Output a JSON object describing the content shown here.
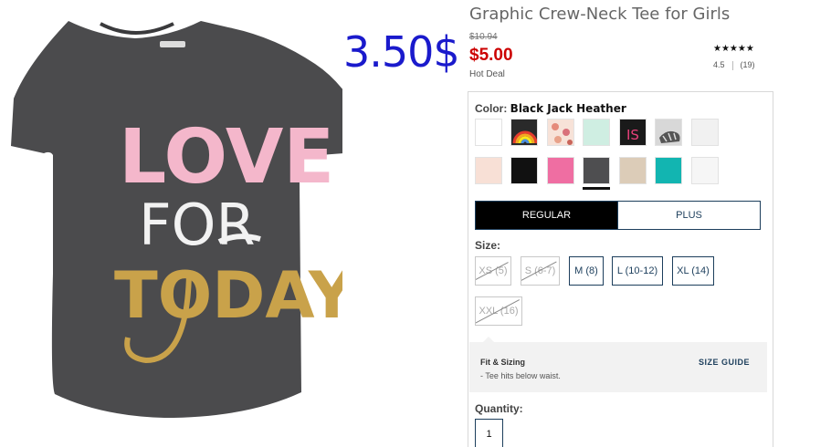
{
  "overlay_price": "3.50$",
  "product": {
    "title": "Graphic Crew-Neck Tee for Girls",
    "old_price": "$10.94",
    "sale_price": "$5.00",
    "deal_label": "Hot Deal",
    "rating_stars": "★★★★★",
    "rating_value": "4.5",
    "rating_count": "(19)",
    "image": {
      "graphic_line1": "LOVE",
      "graphic_line2": "FOR",
      "graphic_line3": "TODAY",
      "shirt_color": "#4b4b4d",
      "pink_color": "#f4b7cb",
      "gold_color": "#c9a24a"
    }
  },
  "color": {
    "label": "Color:",
    "selected": "Black Jack Heather",
    "swatches": [
      {
        "name": "white-1",
        "color": "#f4f4f4"
      },
      {
        "name": "rainbow",
        "color": "#e06b3a"
      },
      {
        "name": "floral-pink",
        "color": "#f0c0b0"
      },
      {
        "name": "mint",
        "color": "#cfeee2"
      },
      {
        "name": "black-is",
        "color": "#1a1a1a"
      },
      {
        "name": "tiger-print",
        "color": "#cfcfcf"
      },
      {
        "name": "white-2",
        "color": "#f1f1f1"
      },
      {
        "name": "blush",
        "color": "#f8e0d6"
      },
      {
        "name": "black",
        "color": "#111111"
      },
      {
        "name": "hot-pink",
        "color": "#ef6ea2"
      },
      {
        "name": "charcoal",
        "color": "#4e4e50"
      },
      {
        "name": "oatmeal",
        "color": "#dcccb8"
      },
      {
        "name": "teal",
        "color": "#12b5b1"
      },
      {
        "name": "white-3",
        "color": "#f6f6f6"
      }
    ]
  },
  "fit": {
    "regular_label": "REGULAR",
    "plus_label": "PLUS"
  },
  "size": {
    "label": "Size:",
    "options": [
      {
        "label": "XS (5)",
        "available": false
      },
      {
        "label": "S (6-7)",
        "available": false
      },
      {
        "label": "M (8)",
        "available": true
      },
      {
        "label": "L (10-12)",
        "available": true
      },
      {
        "label": "XL (14)",
        "available": true
      },
      {
        "label": "XXL (16)",
        "available": false
      }
    ]
  },
  "fit_sizing": {
    "title": "Fit & Sizing",
    "detail": "- Tee hits below waist.",
    "size_guide": "SIZE GUIDE"
  },
  "quantity": {
    "label": "Quantity:",
    "value": "1"
  }
}
